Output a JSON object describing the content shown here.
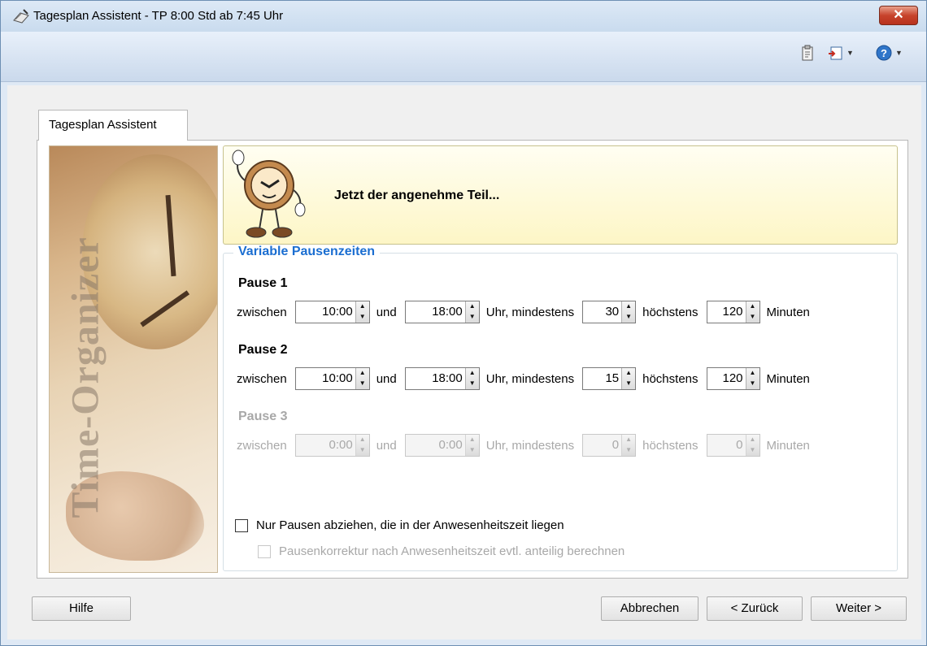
{
  "window": {
    "title": "Tagesplan Assistent - TP 8:00 Std ab 7:45 Uhr",
    "close_label": "✕"
  },
  "toolbar": {
    "icons": [
      "clipboard-icon",
      "exit-icon",
      "help-icon"
    ]
  },
  "tab": {
    "label": "Tagesplan Assistent"
  },
  "side_image": {
    "text": "Time-Organizer"
  },
  "header": {
    "headline": "Jetzt der angenehme Teil..."
  },
  "group": {
    "legend": "Variable Pausenzeiten",
    "pauses": [
      {
        "title": "Pause 1",
        "enabled": true,
        "between": "zwischen",
        "from": "10:00",
        "and": "und",
        "to": "18:00",
        "min_label": "Uhr, mindestens",
        "min": "30",
        "max_label": "höchstens",
        "max": "120",
        "unit": "Minuten"
      },
      {
        "title": "Pause 2",
        "enabled": true,
        "between": "zwischen",
        "from": "10:00",
        "and": "und",
        "to": "18:00",
        "min_label": "Uhr, mindestens",
        "min": "15",
        "max_label": "höchstens",
        "max": "120",
        "unit": "Minuten"
      },
      {
        "title": "Pause 3",
        "enabled": false,
        "between": "zwischen",
        "from": "0:00",
        "and": "und",
        "to": "0:00",
        "min_label": "Uhr, mindestens",
        "min": "0",
        "max_label": "höchstens",
        "max": "0",
        "unit": "Minuten"
      }
    ],
    "check_only_presence": {
      "label": "Nur Pausen abziehen, die in der Anwesenheitszeit liegen",
      "checked": false
    },
    "check_proportional": {
      "label": "Pausenkorrektur nach Anwesenheitszeit evtl. anteilig berechnen",
      "checked": false,
      "enabled": false
    }
  },
  "buttons": {
    "help": "Hilfe",
    "cancel": "Abbrechen",
    "back": "< Zurück",
    "next": "Weiter >"
  }
}
